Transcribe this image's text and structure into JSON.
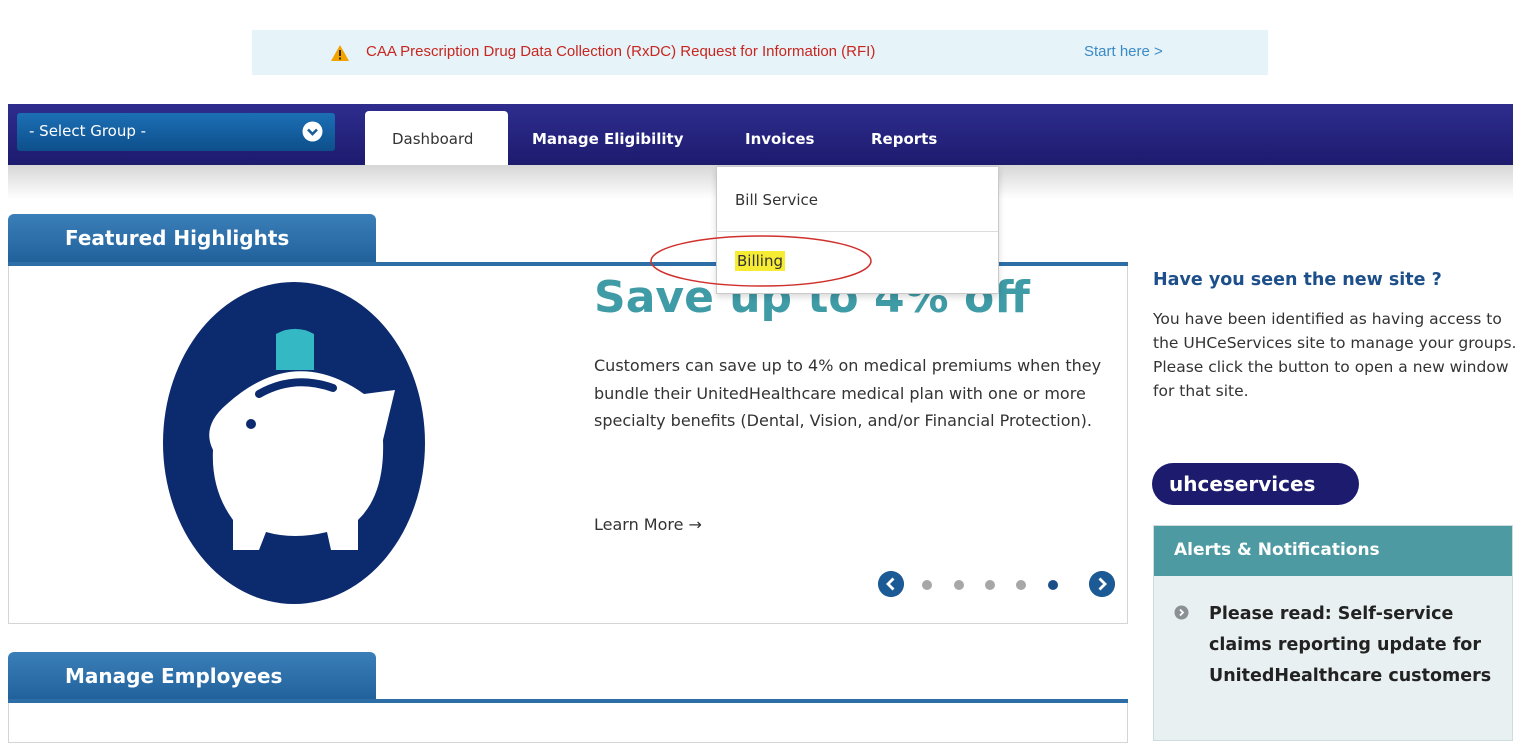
{
  "notice": {
    "message": "CAA Prescription Drug Data Collection (RxDC) Request for Information (RFI)",
    "link": "Start here >"
  },
  "nav": {
    "group_select": "- Select Group -",
    "tabs": [
      {
        "label": "Dashboard",
        "active": true
      },
      {
        "label": "Manage Eligibility"
      },
      {
        "label": "Invoices"
      },
      {
        "label": "Reports"
      }
    ]
  },
  "invoices_menu": {
    "items": [
      {
        "label": "Bill Service"
      },
      {
        "label": "Billing",
        "highlighted": true
      }
    ]
  },
  "featured": {
    "title": "Featured Highlights",
    "promo_title": "Save up to 4% off",
    "promo_text": "Customers can save up to 4% on medical premiums when they bundle their UnitedHealthcare medical plan with one or more specialty benefits (Dental, Vision, and/or Financial Protection).",
    "learn_more": "Learn More →",
    "carousel": {
      "slides": 5,
      "active_index": 5
    }
  },
  "manage": {
    "title": "Manage Employees"
  },
  "sidebar": {
    "new_site_title": "Have you seen the new site ?",
    "new_site_text": "You have been identified as having access to the UHCeServices site to manage your groups. Please click the button to open a new window for that site.",
    "button": "uhceservices",
    "alerts_title": "Alerts & Notifications",
    "alerts": [
      "Please read: Self-service claims reporting update for UnitedHealthcare customers"
    ]
  },
  "colors": {
    "navbar": "#1d1b6e",
    "tab_blue": "#2d6ea7",
    "teal": "#4e9aa2",
    "warning_text": "#c8261f",
    "highlight": "#f7ec34"
  }
}
